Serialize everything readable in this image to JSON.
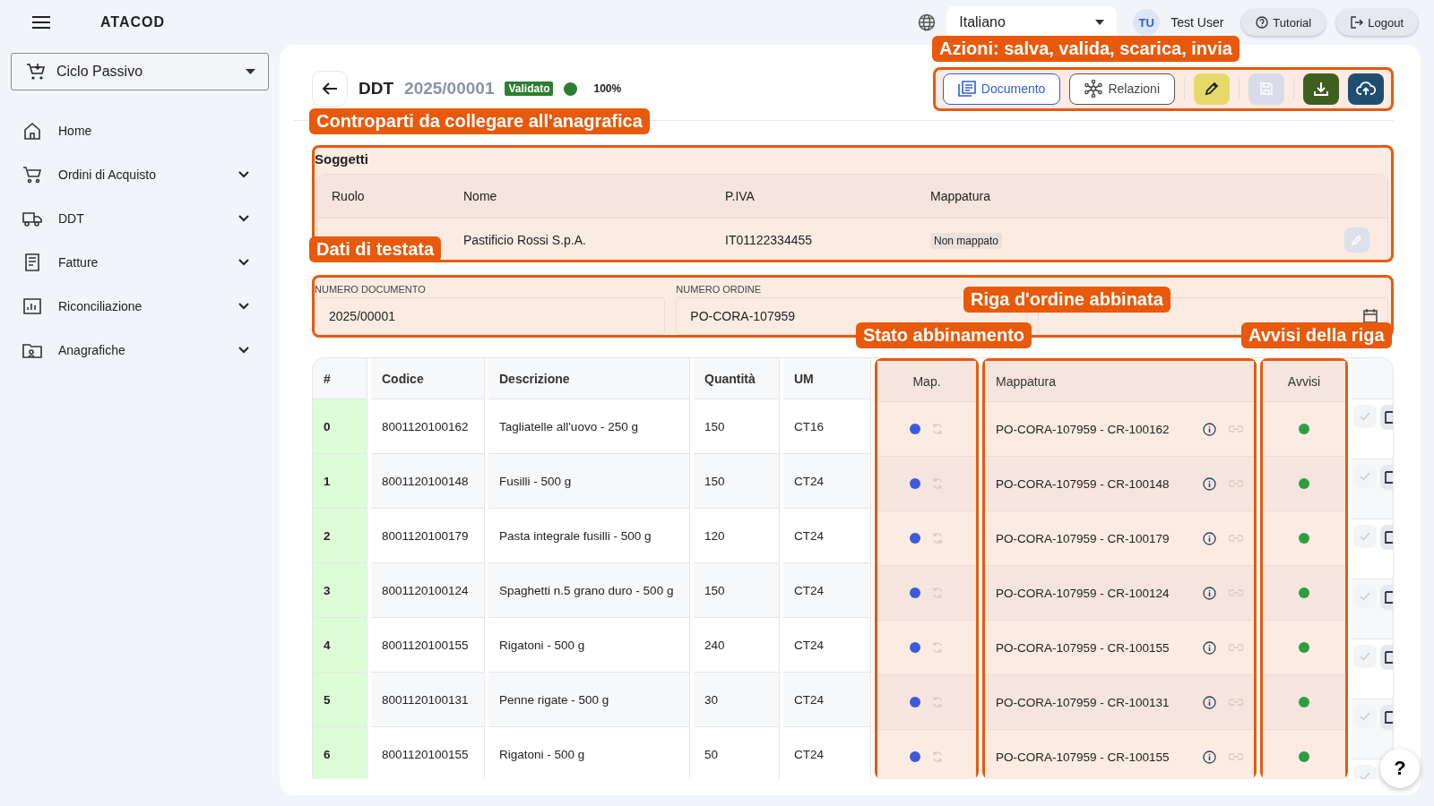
{
  "topbar": {
    "app_name": "ATACOD",
    "language": "Italiano",
    "user_initials": "TU",
    "user_name": "Test User",
    "buttons": [
      {
        "kind": "help",
        "label": "Tutorial"
      },
      {
        "kind": "logout",
        "label": "Logout"
      }
    ]
  },
  "sidebar": {
    "selector": "Ciclo Passivo",
    "items": [
      {
        "label": "Home",
        "kind": "link"
      },
      {
        "label": "Ordini di Acquisto",
        "kind": "group"
      },
      {
        "label": "DDT",
        "kind": "group"
      },
      {
        "label": "Fatture",
        "kind": "group"
      },
      {
        "label": "Riconciliazione",
        "kind": "group"
      },
      {
        "label": "Anagrafiche",
        "kind": "group"
      }
    ]
  },
  "document": {
    "type": "DDT",
    "number": "2025/00001",
    "status": "Validato",
    "progress": "100%",
    "actions": [
      {
        "kind": "outline",
        "label": "Documento",
        "disabled": false
      },
      {
        "kind": "outline",
        "label": "Relazioni",
        "disabled": false
      },
      {
        "kind": "edit",
        "disabled": false
      },
      {
        "kind": "save",
        "disabled": true
      },
      {
        "kind": "download",
        "disabled": false
      },
      {
        "kind": "send",
        "disabled": false
      }
    ]
  },
  "subjects": {
    "title": "Soggetti",
    "columns": [
      "Ruolo",
      "Nome",
      "P.IVA",
      "Mappatura"
    ],
    "rows": [
      {
        "name": "Pastificio Rossi S.p.A.",
        "vat": "IT01122334455",
        "mapping": "Non mappato",
        "edit_disabled": true
      }
    ]
  },
  "header_fields": [
    {
      "kind": "text",
      "label": "NUMERO DOCUMENTO",
      "value": "2025/00001"
    },
    {
      "kind": "text",
      "label": "NUMERO ORDINE",
      "value": "PO-CORA-107959"
    },
    {
      "kind": "date"
    }
  ],
  "table": {
    "columns": [
      {
        "label": "#",
        "highlighted": false
      },
      {
        "label": "Codice",
        "highlighted": false
      },
      {
        "label": "Descrizione",
        "highlighted": false
      },
      {
        "label": "Quantità",
        "highlighted": false
      },
      {
        "label": "UM",
        "highlighted": false
      },
      {
        "label": "Map.",
        "highlighted": true
      },
      {
        "label": "Mappatura",
        "highlighted": true
      },
      {
        "label": "Avvisi",
        "highlighted": true
      }
    ],
    "rows": [
      {
        "index": "0",
        "validated": true,
        "code": "8001120100162",
        "description": "Tagliatelle all'uovo - 250 g",
        "quantity": "150",
        "um": "CT16",
        "mapping": "PO-CORA-107959 - CR-100162"
      },
      {
        "index": "1",
        "validated": true,
        "code": "8001120100148",
        "description": "Fusilli - 500 g",
        "quantity": "150",
        "um": "CT24",
        "mapping": "PO-CORA-107959 - CR-100148"
      },
      {
        "index": "2",
        "validated": true,
        "code": "8001120100179",
        "description": "Pasta integrale fusilli - 500 g",
        "quantity": "120",
        "um": "CT24",
        "mapping": "PO-CORA-107959 - CR-100179"
      },
      {
        "index": "3",
        "validated": true,
        "code": "8001120100124",
        "description": "Spaghetti n.5 grano duro - 500 g",
        "quantity": "150",
        "um": "CT24",
        "mapping": "PO-CORA-107959 - CR-100124"
      },
      {
        "index": "4",
        "validated": true,
        "code": "8001120100155",
        "description": "Rigatoni - 500 g",
        "quantity": "240",
        "um": "CT24",
        "mapping": "PO-CORA-107959 - CR-100155"
      },
      {
        "index": "5",
        "validated": true,
        "code": "8001120100131",
        "description": "Penne rigate - 500 g",
        "quantity": "30",
        "um": "CT24",
        "mapping": "PO-CORA-107959 - CR-100131"
      },
      {
        "index": "6",
        "validated": true,
        "code": "8001120100155",
        "description": "Rigatoni - 500 g",
        "quantity": "50",
        "um": "CT24",
        "mapping": "PO-CORA-107959 - CR-100155"
      }
    ]
  },
  "help_button": "?",
  "annotations": [
    {
      "text": "Azioni: salva, valida, scarica, invia"
    },
    {
      "text": "Controparti da collegare all'anagrafica"
    },
    {
      "text": "Dati di testata"
    },
    {
      "text": "Riga d'ordine abbinata"
    },
    {
      "text": "Stato abbinamento"
    },
    {
      "text": "Avvisi della riga"
    }
  ]
}
